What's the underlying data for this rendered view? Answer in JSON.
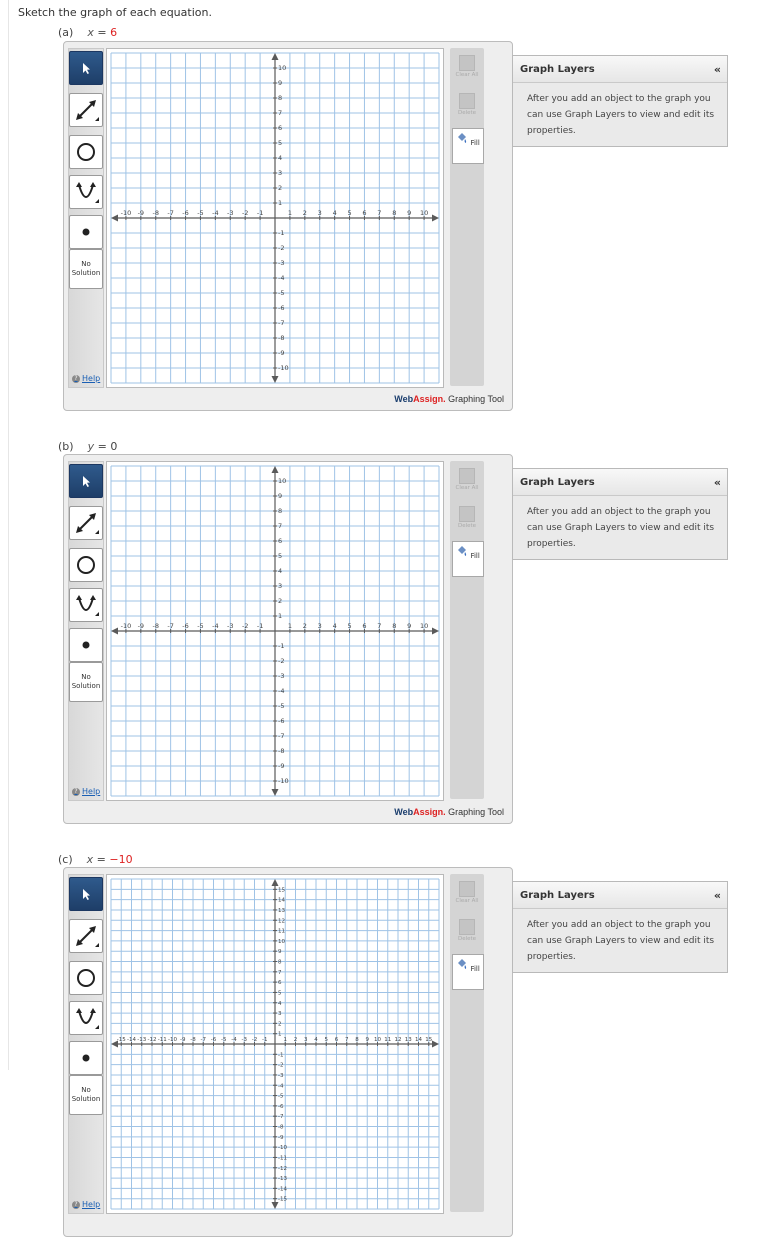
{
  "prompt": "Sketch the graph of each equation.",
  "parts": [
    {
      "letter": "(a)",
      "variable": "x",
      "equals": " = ",
      "value": "6",
      "range": 10
    },
    {
      "letter": "(b)",
      "variable": "y",
      "equals": " = ",
      "value": "0",
      "range": 10
    },
    {
      "letter": "(c)",
      "variable": "x",
      "equals": " = ",
      "value": "−10",
      "range": 15
    }
  ],
  "toolbar": {
    "no_solution_line1": "No",
    "no_solution_line2": "Solution",
    "help_label": "Help"
  },
  "right_panel": {
    "clear_all_label": "Clear All",
    "delete_label": "Delete",
    "fill_label": "Fill"
  },
  "brand": {
    "web": "Web",
    "assign": "Assign",
    "dot": ".",
    "tool": " Graphing Tool"
  },
  "layers": {
    "title": "Graph Layers",
    "collapse": "«",
    "body": "After you add an object to the graph you can use Graph Layers to view and edit its properties."
  },
  "colors": {
    "grid": "#9fc3e6",
    "axis": "#5a5a5a",
    "active_tool": "#244a7a",
    "equation_value": "#dd2222"
  }
}
